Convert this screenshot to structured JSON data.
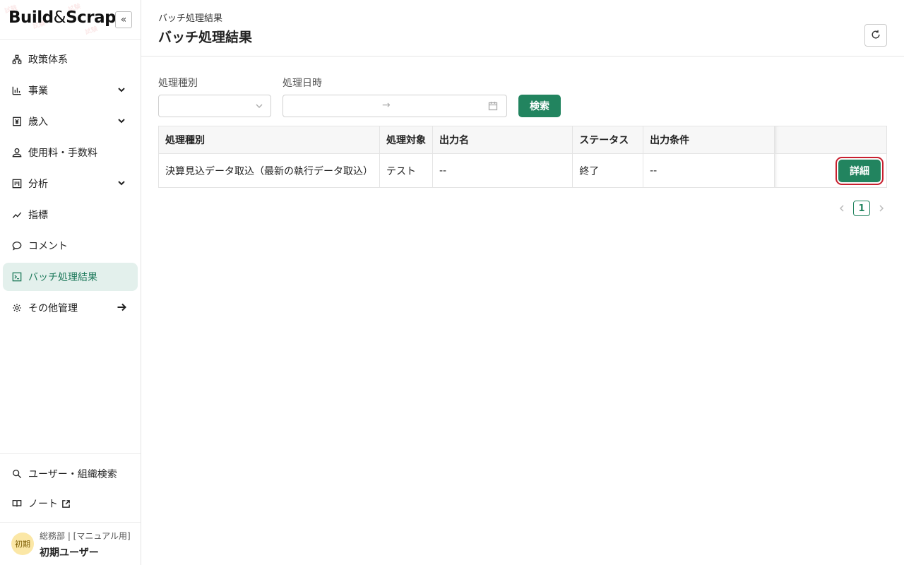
{
  "brand": {
    "logo_part1": "Build",
    "logo_amp": "&",
    "logo_part2": "Scrap",
    "watermark": "試験"
  },
  "sidebar": {
    "collapse_label": "«",
    "items": [
      {
        "label": "政策体系",
        "icon": "hierarchy-icon"
      },
      {
        "label": "事業",
        "icon": "bar-chart-icon",
        "expandable": true
      },
      {
        "label": "歳入",
        "icon": "yen-receipt-icon",
        "expandable": true
      },
      {
        "label": "使用料・手数料",
        "icon": "coins-icon"
      },
      {
        "label": "分析",
        "icon": "board-icon",
        "expandable": true
      },
      {
        "label": "指標",
        "icon": "trend-icon"
      },
      {
        "label": "コメント",
        "icon": "comment-icon"
      },
      {
        "label": "バッチ処理結果",
        "icon": "terminal-icon",
        "active": true
      },
      {
        "label": "その他管理",
        "icon": "gear-icon"
      }
    ],
    "bottom_items": [
      {
        "label": "ユーザー・組織検索",
        "icon": "search-icon"
      },
      {
        "label": "ノート",
        "icon": "book-icon"
      }
    ],
    "user": {
      "avatar": "初期",
      "org": "総務部 | [マニュアル用]",
      "name": "初期ユーザー"
    }
  },
  "header": {
    "breadcrumb": "バッチ処理結果",
    "title": "バッチ処理結果"
  },
  "filters": {
    "type_label": "処理種別",
    "date_label": "処理日時",
    "date_separator": "→",
    "search_label": "検索"
  },
  "table": {
    "columns": [
      "処理種別",
      "処理対象",
      "出力名",
      "ステータス",
      "出力条件",
      ""
    ],
    "rows": [
      {
        "type": "決算見込データ取込（最新の執行データ取込）",
        "target": "テスト",
        "output": "--",
        "status": "終了",
        "condition": "--",
        "action": "詳細"
      }
    ]
  },
  "pagination": {
    "current": "1"
  },
  "colors": {
    "accent": "#22845f",
    "active_bg": "#e3f0ec",
    "highlight": "#c8202f"
  }
}
